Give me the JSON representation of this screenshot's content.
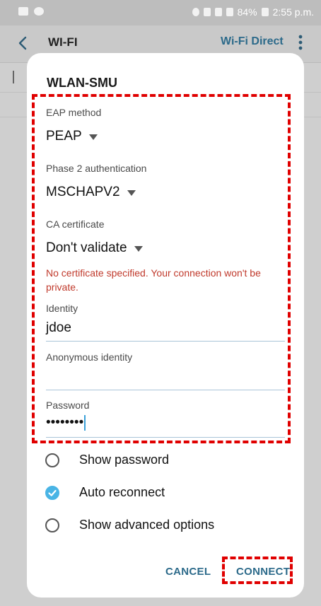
{
  "status_bar": {
    "battery": "84%",
    "time": "2:55 p.m."
  },
  "header": {
    "title": "WI-FI",
    "action_label": "Wi-Fi Direct"
  },
  "dialog": {
    "title": "WLAN-SMU",
    "eap_method": {
      "label": "EAP method",
      "value": "PEAP"
    },
    "phase2": {
      "label": "Phase 2 authentication",
      "value": "MSCHAPV2"
    },
    "ca_certificate": {
      "label": "CA certificate",
      "value": "Don't validate"
    },
    "warning": "No certificate specified. Your connection won't be private.",
    "identity": {
      "label": "Identity",
      "value": "jdoe"
    },
    "anonymous_identity": {
      "label": "Anonymous identity",
      "value": ""
    },
    "password": {
      "label": "Password",
      "value": "••••••••"
    },
    "options": [
      {
        "label": "Show password",
        "checked": false
      },
      {
        "label": "Auto reconnect",
        "checked": true
      },
      {
        "label": "Show advanced options",
        "checked": false
      }
    ],
    "cancel_label": "CANCEL",
    "connect_label": "CONNECT"
  },
  "colors": {
    "accent": "#2c6a8a",
    "checkbox": "#49b4e5",
    "warning": "#c0392b",
    "highlight": "#e00000"
  }
}
